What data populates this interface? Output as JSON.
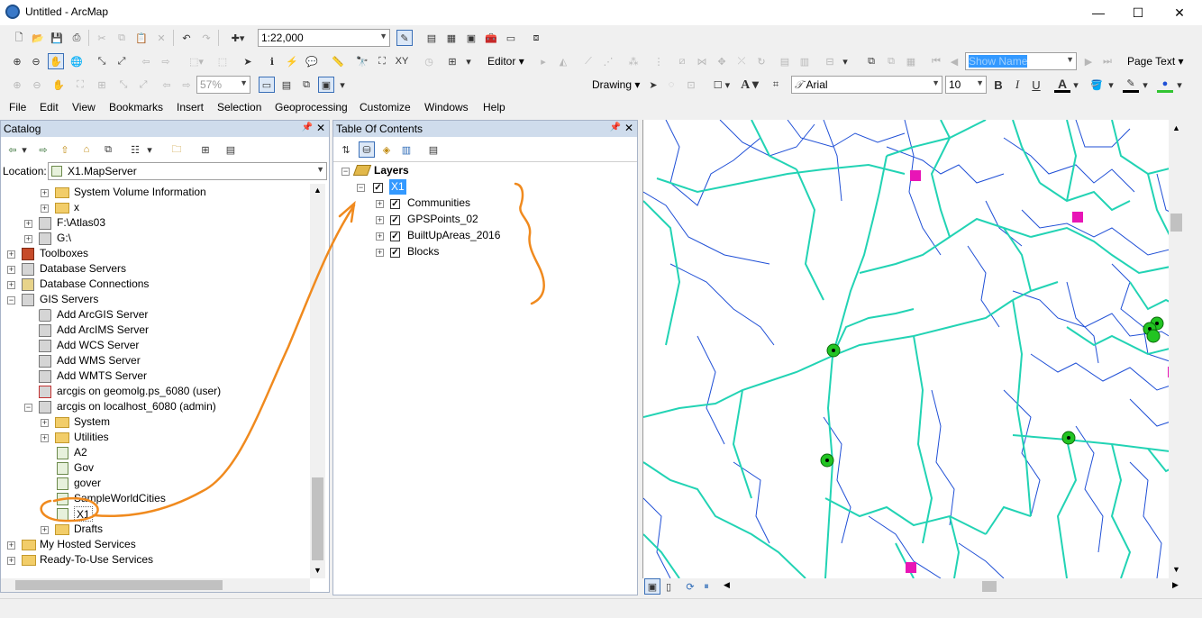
{
  "window": {
    "title": "Untitled - ArcMap",
    "minimize": "—",
    "maximize": "☐",
    "close": "✕"
  },
  "standard_toolbar": {
    "scale": "1:22,000"
  },
  "tools_toolbar": {
    "editor_label": "Editor",
    "show_name": "Show Name",
    "page_text": "Page Text"
  },
  "layout_toolbar": {
    "zoom_percent": "57%"
  },
  "draw_toolbar": {
    "drawing_label": "Drawing",
    "font_name": "Arial",
    "font_size": "10",
    "bold": "B",
    "italic": "I",
    "underline": "U",
    "font_color": "A"
  },
  "menu": [
    "File",
    "Edit",
    "View",
    "Bookmarks",
    "Insert",
    "Selection",
    "Geoprocessing",
    "Customize",
    "Windows",
    "Help"
  ],
  "catalog": {
    "title": "Catalog",
    "location_label": "Location:",
    "location_value": "X1.MapServer",
    "items": [
      {
        "label": "System Volume Information"
      },
      {
        "label": "x"
      },
      {
        "label": "F:\\Atlas03"
      },
      {
        "label": "G:\\"
      },
      {
        "label": "Toolboxes"
      },
      {
        "label": "Database Servers"
      },
      {
        "label": "Database Connections"
      },
      {
        "label": "GIS Servers"
      },
      {
        "label": "Add ArcGIS Server"
      },
      {
        "label": "Add ArcIMS Server"
      },
      {
        "label": "Add WCS Server"
      },
      {
        "label": "Add WMS Server"
      },
      {
        "label": "Add WMTS Server"
      },
      {
        "label": "arcgis on geomolg.ps_6080 (user)"
      },
      {
        "label": "arcgis on localhost_6080 (admin)"
      },
      {
        "label": "System"
      },
      {
        "label": "Utilities"
      },
      {
        "label": "A2"
      },
      {
        "label": "Gov"
      },
      {
        "label": "gover"
      },
      {
        "label": "SampleWorldCities"
      },
      {
        "label": "X1"
      },
      {
        "label": "Drafts"
      },
      {
        "label": "My Hosted Services"
      },
      {
        "label": "Ready-To-Use Services"
      }
    ]
  },
  "toc": {
    "title": "Table Of Contents",
    "root": "Layers",
    "group": "X1",
    "layers": [
      {
        "label": "Communities",
        "checked": true
      },
      {
        "label": "GPSPoints_02",
        "checked": true
      },
      {
        "label": "BuiltUpAreas_2016",
        "checked": true
      },
      {
        "label": "Blocks",
        "checked": true
      }
    ]
  },
  "colors": {
    "boundary": "#22d3b4",
    "blocks": "#1f4fd6",
    "gps_point": "#22c422",
    "community": "#e815b6",
    "annotation": "#f08a1e",
    "selection": "#3399ff"
  },
  "icons": [
    "catalog-back-icon",
    "catalog-forward-icon",
    "up-folder-icon",
    "home-icon",
    "connect-folder-icon",
    "pin-icon",
    "close-icon"
  ]
}
